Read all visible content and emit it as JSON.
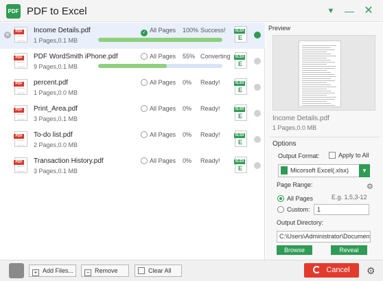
{
  "app": {
    "title": "PDF to Excel",
    "logo_text": "PDF"
  },
  "files": [
    {
      "name": "Income Details.pdf",
      "meta": "1 Pages,0.1 MB",
      "pages": "All Pages",
      "percent": "100%",
      "status": "Success!",
      "progress": 1.0,
      "state": "done",
      "selected": true
    },
    {
      "name": "PDF WordSmith iPhone.pdf",
      "meta": "9 Pages,0.1 MB",
      "pages": "All Pages",
      "percent": "55%",
      "status": "Converting",
      "progress": 0.55,
      "state": "converting",
      "selected": false
    },
    {
      "name": "percent.pdf",
      "meta": "1 Pages,0.0 MB",
      "pages": "All Pages",
      "percent": "0%",
      "status": "Ready!",
      "state": "ready",
      "selected": false
    },
    {
      "name": "Print_Area.pdf",
      "meta": "3 Pages,0.1 MB",
      "pages": "All Pages",
      "percent": "0%",
      "status": "Ready!",
      "state": "ready",
      "selected": false
    },
    {
      "name": "To-do list.pdf",
      "meta": "2 Pages,0.0 MB",
      "pages": "All Pages",
      "percent": "0%",
      "status": "Ready!",
      "state": "ready",
      "selected": false
    },
    {
      "name": "Transaction History.pdf",
      "meta": "3 Pages,0.1 MB",
      "pages": "All Pages",
      "percent": "0%",
      "status": "Ready!",
      "state": "ready",
      "selected": false
    }
  ],
  "icons": {
    "pdf_tag": "PDF",
    "xlsx_tag": "XLSX"
  },
  "preview": {
    "label": "Preview",
    "file_name": "Income Details.pdf",
    "file_meta": "1 Pages,0.0 MB"
  },
  "options": {
    "label": "Options",
    "output_format_label": "Output Format:",
    "apply_to_all": "Apply to All",
    "format_value": "Micorsoft Excel(.xlsx)",
    "page_range_label": "Page Range:",
    "all_pages": "All Pages",
    "custom": "Custom:",
    "example": "E.g. 1,5,3-12",
    "custom_value": "1",
    "output_dir_label": "Output Directory:",
    "output_dir_value": "C:\\Users\\Administrator\\Documents",
    "browse": "Browse",
    "reveal": "Reveal"
  },
  "bottom": {
    "add_files": "Add Files...",
    "remove": "Remove",
    "clear_all": "Clear All",
    "cancel": "Cancel"
  },
  "colors": {
    "accent": "#2f9b55",
    "cancel": "#e23b2e",
    "selected_row": "#e9f0fb"
  }
}
